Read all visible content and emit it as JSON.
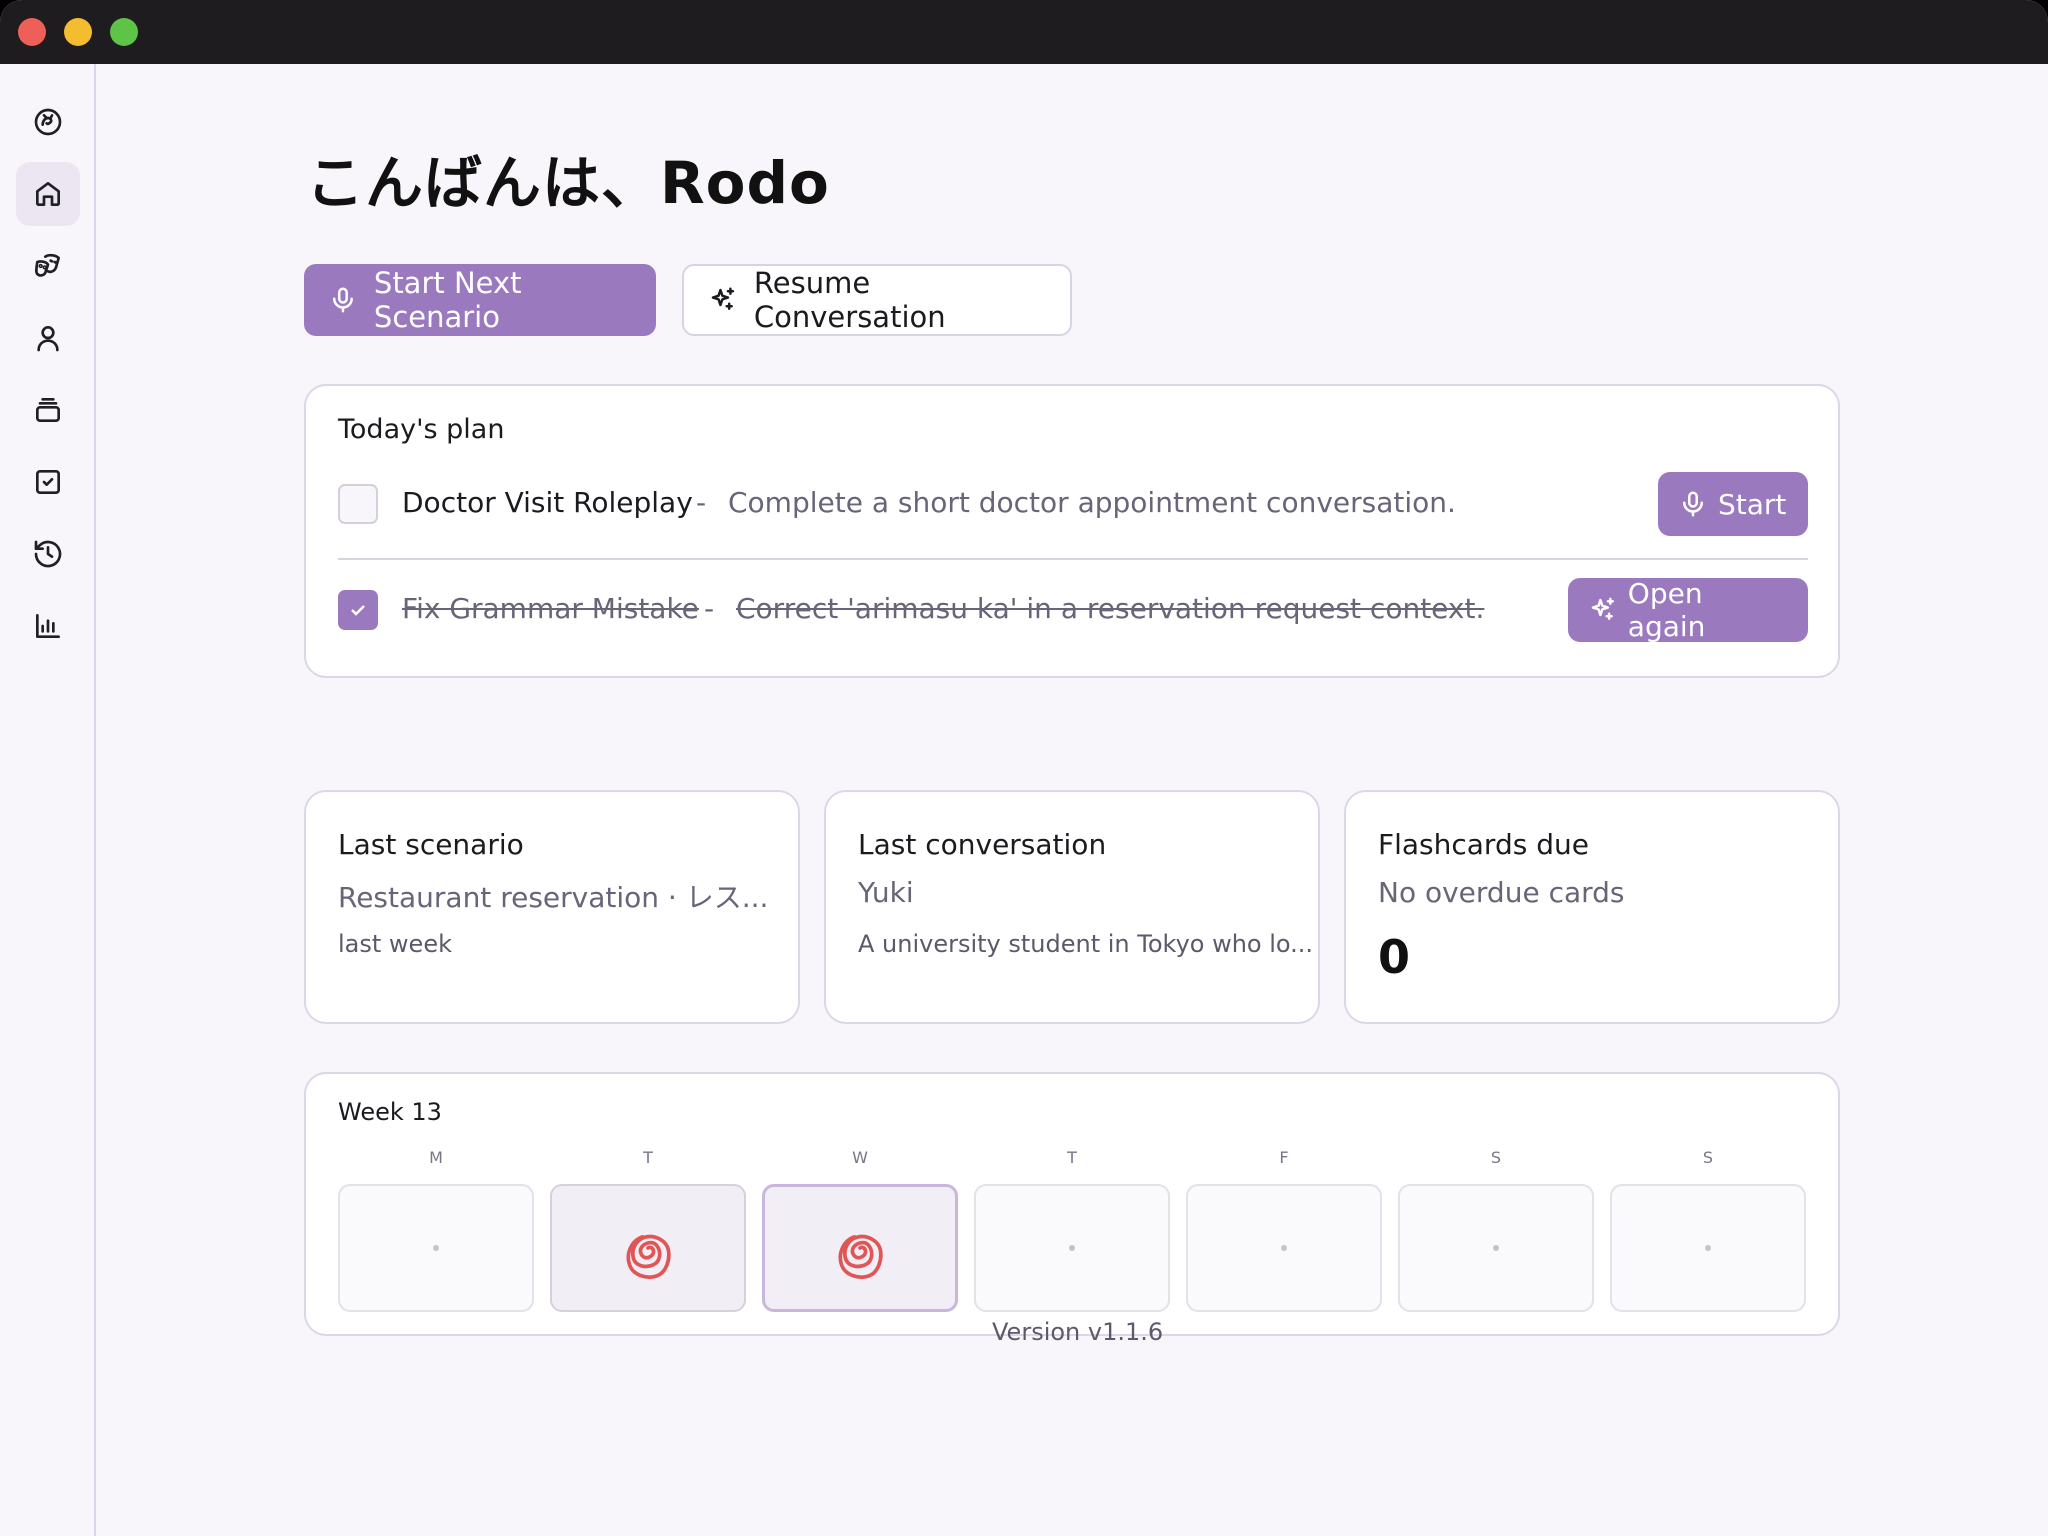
{
  "window": {
    "traffic_lights": [
      "close",
      "minimize",
      "maximize"
    ]
  },
  "sidebar": {
    "items": [
      {
        "icon": "logo-icon",
        "active": false
      },
      {
        "icon": "home-icon",
        "active": true
      },
      {
        "icon": "theater-masks-icon",
        "active": false
      },
      {
        "icon": "user-icon",
        "active": false
      },
      {
        "icon": "stack-icon",
        "active": false
      },
      {
        "icon": "checkbox-icon",
        "active": false
      },
      {
        "icon": "history-icon",
        "active": false
      },
      {
        "icon": "chart-icon",
        "active": false
      }
    ],
    "settings_icon": "gear-icon",
    "status_color": "#5e8a6a"
  },
  "header": {
    "greeting": "こんばんは、Rodo"
  },
  "actions": {
    "primary_label": "Start Next Scenario",
    "secondary_label": "Resume Conversation"
  },
  "plan": {
    "title": "Today's plan",
    "items": [
      {
        "title": "Doctor Visit Roleplay",
        "separator": "-",
        "description": "Complete a short doctor appointment conversation.",
        "done": false,
        "action_label": "Start"
      },
      {
        "title": "Fix Grammar Mistake",
        "separator": "-",
        "description": "Correct 'arimasu ka' in a reservation request context.",
        "done": true,
        "action_label": "Open again"
      }
    ]
  },
  "stats": {
    "last_scenario": {
      "title": "Last scenario",
      "subtitle": "Restaurant reservation · レス...",
      "meta": "last week"
    },
    "last_conversation": {
      "title": "Last conversation",
      "subtitle": "Yuki",
      "meta": "A university student in Tokyo who lo..."
    },
    "flashcards": {
      "title": "Flashcards due",
      "subtitle": "No overdue cards",
      "count": "0"
    }
  },
  "week": {
    "title": "Week 13",
    "days": [
      {
        "label": "M",
        "state": "empty"
      },
      {
        "label": "T",
        "state": "done"
      },
      {
        "label": "W",
        "state": "today-done"
      },
      {
        "label": "T",
        "state": "empty"
      },
      {
        "label": "F",
        "state": "empty"
      },
      {
        "label": "S",
        "state": "empty"
      },
      {
        "label": "S",
        "state": "empty"
      }
    ]
  },
  "footer": {
    "version": "Version v1.1.6"
  },
  "colors": {
    "accent": "#9b79bf",
    "spiral": "#e05555",
    "background": "#f8f6fa"
  }
}
